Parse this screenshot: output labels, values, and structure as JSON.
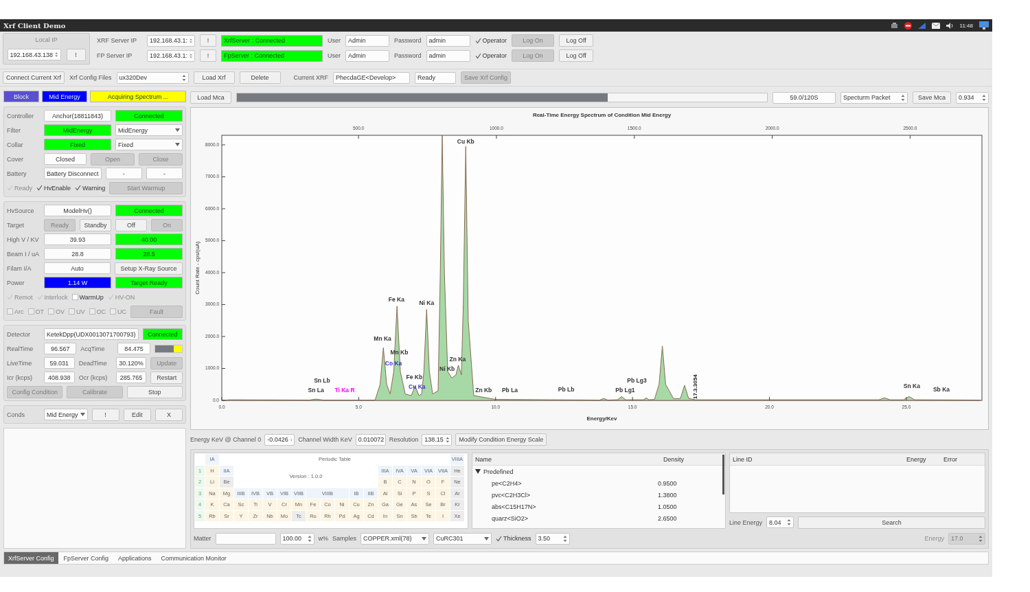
{
  "window": {
    "title": "Xrf Client Demo",
    "clock": "11:48"
  },
  "connection": {
    "local_ip": {
      "title": "Local IP",
      "ip": {
        "kind": "spin",
        "value": "192.168.43.138"
      },
      "button": {
        "kind": "button",
        "text": "!",
        "disabled": false
      }
    },
    "servers": [
      [
        {
          "kind": "label",
          "text": "XRF Server IP"
        },
        {
          "kind": "spin",
          "value": "192.168.43.1:"
        },
        {
          "kind": "button",
          "text": "!",
          "disabled": false
        },
        {
          "kind": "status",
          "text": "XrfServer : Connected",
          "color": "#00ff00"
        },
        {
          "kind": "label",
          "text": "User"
        },
        {
          "kind": "field",
          "value": "Admin"
        },
        {
          "kind": "label",
          "text": "Password"
        },
        {
          "kind": "field",
          "value": "admin"
        },
        {
          "kind": "check",
          "text": "Operator",
          "checked": true,
          "disabled": false
        },
        {
          "kind": "button",
          "text": "Log On",
          "disabled": true
        },
        {
          "kind": "button",
          "text": "Log Off",
          "disabled": false
        }
      ],
      [
        {
          "kind": "label",
          "text": "FP Server IP"
        },
        {
          "kind": "spin",
          "value": "192.168.43.1:"
        },
        {
          "kind": "button",
          "text": "!",
          "disabled": false
        },
        {
          "kind": "status",
          "text": "FpServer : Connected",
          "color": "#00ff00"
        },
        {
          "kind": "label",
          "text": "User"
        },
        {
          "kind": "field",
          "value": "Admin"
        },
        {
          "kind": "label",
          "text": "Password"
        },
        {
          "kind": "field",
          "value": "admin"
        },
        {
          "kind": "check",
          "text": "Operator",
          "checked": true,
          "disabled": false
        },
        {
          "kind": "button",
          "text": "Log On",
          "disabled": true
        },
        {
          "kind": "button",
          "text": "Log Off",
          "disabled": false
        }
      ]
    ]
  },
  "config_bar": [
    {
      "kind": "button",
      "text": "Connect Current Xrf",
      "disabled": false
    },
    {
      "kind": "label",
      "text": "Xrf Config Files"
    },
    {
      "kind": "spin",
      "value": "ux320Dev"
    },
    {
      "kind": "button",
      "text": "Load Xrf",
      "disabled": false
    },
    {
      "kind": "button",
      "text": "Delete",
      "disabled": false
    },
    {
      "kind": "label",
      "text": "Current XRF"
    },
    {
      "kind": "field",
      "value": "PhecdaGE<Develop>"
    },
    {
      "kind": "field",
      "value": "Ready"
    },
    {
      "kind": "button",
      "text": "Save Xrf Config",
      "disabled": true
    }
  ],
  "left_panel": {
    "badges": [
      {
        "kind": "status",
        "text": "Block",
        "color": "#5a4fcf"
      },
      {
        "kind": "status",
        "text": "Mid Energy",
        "color": "#0000ff"
      },
      {
        "kind": "status",
        "text": "Acquiring Spectrum ...",
        "color": "#ffff00"
      }
    ],
    "groups": [
      {
        "lines": [
          {
            "items": [
              {
                "kind": "label",
                "text": "Controller"
              },
              {
                "kind": "field",
                "value": "Anchor(18811843)"
              },
              {
                "kind": "status",
                "text": "Connected",
                "color": "#00ff00"
              }
            ]
          },
          {
            "items": [
              {
                "kind": "label",
                "text": "Filter"
              },
              {
                "kind": "status",
                "text": "MidEnergy",
                "color": "#00ff00"
              },
              {
                "kind": "combo",
                "value": "MidEnergy"
              }
            ]
          },
          {
            "items": [
              {
                "kind": "label",
                "text": "Collar"
              },
              {
                "kind": "status",
                "text": "Fixed",
                "color": "#00ff00"
              },
              {
                "kind": "combo",
                "value": "Fixed"
              }
            ]
          },
          {
            "items": [
              {
                "kind": "label",
                "text": "Cover"
              },
              {
                "kind": "field",
                "value": "Closed"
              },
              {
                "kind": "button",
                "text": "Open",
                "disabled": true
              },
              {
                "kind": "button",
                "text": "Close",
                "disabled": true
              }
            ]
          },
          {
            "items": [
              {
                "kind": "label",
                "text": "Battery"
              },
              {
                "kind": "field",
                "value": "Battery Disconnect"
              },
              {
                "kind": "field",
                "value": "-"
              },
              {
                "kind": "field",
                "value": "-"
              }
            ]
          },
          {
            "items": [
              {
                "kind": "check",
                "text": "Ready",
                "checked": true,
                "disabled": true
              },
              {
                "kind": "check",
                "text": "HvEnable",
                "checked": true,
                "disabled": false
              },
              {
                "kind": "check",
                "text": "Warning",
                "checked": true,
                "disabled": false
              },
              {
                "kind": "button",
                "text": "Start Warmup",
                "disabled": true
              }
            ]
          }
        ]
      },
      {
        "lines": [
          {
            "items": [
              {
                "kind": "label",
                "text": "HvSource"
              },
              {
                "kind": "field",
                "value": "ModelHv()"
              },
              {
                "kind": "status",
                "text": "Connected",
                "color": "#00ff00"
              }
            ]
          },
          {
            "items": [
              {
                "kind": "label",
                "text": "Target"
              },
              {
                "kind": "button",
                "text": "Ready",
                "disabled": true
              },
              {
                "kind": "button",
                "text": "Standby",
                "disabled": false
              },
              {
                "kind": "button",
                "text": "Off",
                "disabled": false
              },
              {
                "kind": "button",
                "text": "On",
                "disabled": true
              }
            ]
          },
          {
            "items": [
              {
                "kind": "label",
                "text": "High V / KV"
              },
              {
                "kind": "field",
                "value": "39.93"
              },
              {
                "kind": "status",
                "text": "40.00",
                "color": "#00ff00"
              }
            ]
          },
          {
            "items": [
              {
                "kind": "label",
                "text": "Beam I / uA"
              },
              {
                "kind": "field",
                "value": "28.8"
              },
              {
                "kind": "status",
                "text": "28.5",
                "color": "#00ff00"
              }
            ]
          },
          {
            "items": [
              {
                "kind": "label",
                "text": "Filam I/A"
              },
              {
                "kind": "field",
                "value": "Auto"
              },
              {
                "kind": "button",
                "text": "Setup X-Ray Source",
                "disabled": false
              }
            ]
          },
          {
            "items": [
              {
                "kind": "label",
                "text": "Power"
              },
              {
                "kind": "status",
                "text": "1.14 W",
                "color": "#0000ff"
              },
              {
                "kind": "status",
                "text": "Target Ready",
                "color": "#00ff00"
              }
            ]
          },
          {
            "items": [
              {
                "kind": "check",
                "text": "Remot",
                "checked": true,
                "disabled": true
              },
              {
                "kind": "check",
                "text": "Interlock",
                "checked": true,
                "disabled": true
              },
              {
                "kind": "check",
                "text": "WarmUp",
                "checked": false,
                "disabled": false
              },
              {
                "kind": "check",
                "text": "HV-ON",
                "checked": true,
                "disabled": true
              }
            ]
          },
          {
            "items": [
              {
                "kind": "check",
                "text": "Arc",
                "checked": false,
                "disabled": true
              },
              {
                "kind": "check",
                "text": "OT",
                "checked": false,
                "disabled": true
              },
              {
                "kind": "check",
                "text": "OV",
                "checked": false,
                "disabled": true
              },
              {
                "kind": "check",
                "text": "UV",
                "checked": false,
                "disabled": true
              },
              {
                "kind": "check",
                "text": "OC",
                "checked": false,
                "disabled": true
              },
              {
                "kind": "check",
                "text": "UC",
                "checked": false,
                "disabled": true
              },
              {
                "kind": "button",
                "text": "Fault",
                "disabled": true
              }
            ]
          }
        ]
      },
      {
        "lines": [
          {
            "items": [
              {
                "kind": "label",
                "text": "Detector"
              },
              {
                "kind": "field",
                "value": "KetekDpp(UDX0013071700793)"
              },
              {
                "kind": "status",
                "text": "Connected",
                "color": "#00ff00"
              }
            ]
          },
          {
            "items": [
              {
                "kind": "label",
                "text": "RealTime"
              },
              {
                "kind": "field",
                "value": "96.567"
              },
              {
                "kind": "label",
                "text": "AcqTime"
              },
              {
                "kind": "field",
                "value": "84.475"
              },
              {
                "kind": "bar",
                "level": 0.7
              }
            ]
          },
          {
            "items": [
              {
                "kind": "label",
                "text": "LiveTime"
              },
              {
                "kind": "field",
                "value": "59.031"
              },
              {
                "kind": "label",
                "text": "DeadTime"
              },
              {
                "kind": "field",
                "value": "30.120%"
              },
              {
                "kind": "button",
                "text": "Update",
                "disabled": true
              }
            ]
          },
          {
            "items": [
              {
                "kind": "label",
                "text": "Icr (kcps)"
              },
              {
                "kind": "field",
                "value": "408.938"
              },
              {
                "kind": "label",
                "text": "Ocr (kcps)"
              },
              {
                "kind": "field",
                "value": "285.765"
              },
              {
                "kind": "button",
                "text": "Restart",
                "disabled": false
              }
            ]
          },
          {
            "items": [
              {
                "kind": "button",
                "text": "Config Condition",
                "disabled": true
              },
              {
                "kind": "button",
                "text": "Calibrate",
                "disabled": true
              },
              {
                "kind": "button",
                "text": "Stop",
                "disabled": false
              }
            ]
          }
        ]
      }
    ],
    "conditions": [
      {
        "kind": "label",
        "text": "Conds"
      },
      {
        "kind": "combo",
        "value": "Mid Energy"
      },
      {
        "kind": "button",
        "text": "!",
        "disabled": false
      },
      {
        "kind": "button",
        "text": "Edit",
        "disabled": false
      },
      {
        "kind": "button",
        "text": "X",
        "disabled": false
      }
    ]
  },
  "spectrum_toolbar": [
    {
      "kind": "button",
      "text": "Load Mca",
      "disabled": false
    },
    {
      "kind": "bar",
      "level": 0.7
    },
    {
      "kind": "field",
      "value": "59.0/120S"
    },
    {
      "kind": "spin",
      "value": "Specturm Packet"
    },
    {
      "kind": "button",
      "text": "Save Mca",
      "disabled": false
    },
    {
      "kind": "spin",
      "value": "0.934"
    }
  ],
  "spectrum": {
    "top_axis_ticks": [
      "500.0",
      "1000.0",
      "1500.0",
      "2000.0",
      "2500.0"
    ],
    "peak_labels": [
      {
        "text": "Cu Kb",
        "color": "#333333"
      },
      {
        "text": "Fe Ka",
        "color": "#333333"
      },
      {
        "text": "Ni Ka",
        "color": "#333333"
      },
      {
        "text": "Mn Ka",
        "color": "#333333"
      },
      {
        "text": "Mn Kb",
        "color": "#333333"
      },
      {
        "text": "Co Ka",
        "color": "#3333cc"
      },
      {
        "text": "Zn Ka",
        "color": "#333333"
      },
      {
        "text": "Ni Kb",
        "color": "#333333"
      },
      {
        "text": "Fe Kb",
        "color": "#333333"
      },
      {
        "text": "Cu Ka",
        "color": "#3333cc"
      },
      {
        "text": "Sn Lb",
        "color": "#333333"
      },
      {
        "text": "Sn La",
        "color": "#333333"
      },
      {
        "text": "Ti Ka R",
        "color": "#ff00ff"
      },
      {
        "text": "Zn Kb",
        "color": "#333333"
      },
      {
        "text": "Pb La",
        "color": "#333333"
      },
      {
        "text": "Pb Lb",
        "color": "#333333"
      },
      {
        "text": "Pb Lg3",
        "color": "#333333"
      },
      {
        "text": "Pb Lg1",
        "color": "#333333"
      },
      {
        "text": "Sn Ka",
        "color": "#333333"
      },
      {
        "text": "Sb Ka",
        "color": "#333333"
      }
    ],
    "marker_label": "17.3.3054",
    "chart_data": {
      "type": "area",
      "title": "Real-Time Energy Spectrum of Condition Mid Energy",
      "xlabel": "Energy/Kev",
      "ylabel": "Count Rate - cps/(uA)",
      "xlim": [
        0,
        27.76
      ],
      "ylim": [
        0,
        8300
      ],
      "xticks": [
        {
          "value": 0,
          "label": "0.0"
        },
        {
          "value": 5,
          "label": "5.0"
        },
        {
          "value": 10,
          "label": "10.0"
        },
        {
          "value": 15,
          "label": "15.0"
        },
        {
          "value": 20,
          "label": "20.0"
        },
        {
          "value": 25,
          "label": "25.0"
        }
      ],
      "yticks": [
        {
          "value": 0,
          "label": "0.0"
        },
        {
          "value": 1000,
          "label": "1000.0"
        },
        {
          "value": 2000,
          "label": "2000.0"
        },
        {
          "value": 3000,
          "label": "3000.0"
        },
        {
          "value": 4000,
          "label": "4000.0"
        },
        {
          "value": 5000,
          "label": "5000.0"
        },
        {
          "value": 6000,
          "label": "6000.0"
        },
        {
          "value": 7000,
          "label": "7000.0"
        },
        {
          "value": 8000,
          "label": "8000.0"
        }
      ],
      "x": [
        0,
        0.3,
        3.2,
        3.44,
        3.7,
        5.6,
        5.78,
        5.9,
        6.02,
        6.15,
        6.28,
        6.4,
        6.52,
        6.7,
        6.92,
        7.06,
        7.2,
        7.3,
        7.38,
        7.48,
        7.58,
        7.7,
        7.9,
        7.98,
        8.05,
        8.13,
        8.25,
        8.4,
        8.55,
        8.64,
        8.75,
        8.82,
        8.91,
        9.0,
        9.2,
        10,
        13.8,
        13.95,
        14.1,
        14.45,
        14.6,
        14.75,
        15.4,
        15.5,
        15.6,
        15.8,
        15.97,
        16.09,
        16.21,
        16.5,
        16.75,
        16.9,
        17.05,
        17.3,
        24.0,
        24.2,
        24.4,
        24.9,
        25.1,
        25.3,
        27.7
      ],
      "series": [
        {
          "color": "#a6d9a6",
          "values": [
            0,
            20,
            10,
            40,
            10,
            10,
            500,
            1650,
            500,
            200,
            900,
            2950,
            900,
            200,
            150,
            450,
            150,
            200,
            900,
            2850,
            900,
            200,
            300,
            4000,
            8300,
            4000,
            900,
            700,
            800,
            1100,
            800,
            3000,
            7950,
            2500,
            150,
            30,
            10,
            60,
            10,
            20,
            120,
            20,
            20,
            80,
            20,
            30,
            500,
            1700,
            500,
            50,
            60,
            470,
            60,
            20,
            20,
            80,
            20,
            20,
            120,
            20,
            10
          ]
        }
      ]
    }
  },
  "calibration_bar": [
    {
      "kind": "label",
      "text": "Energy KeV @ Channel 0"
    },
    {
      "kind": "spin",
      "value": "-0.0426"
    },
    {
      "kind": "label",
      "text": "Channel Width KeV"
    },
    {
      "kind": "spin",
      "value": "0.010072"
    },
    {
      "kind": "label",
      "text": "Resolution"
    },
    {
      "kind": "spin",
      "value": "138.15"
    },
    {
      "kind": "button",
      "text": "Modify Condition  Energy Scale",
      "disabled": false
    }
  ],
  "periodic_table": {
    "cells": [
      {
        "kind": "blank"
      },
      {
        "kind": "group",
        "text": "IA"
      },
      {
        "kind": "title",
        "text": "Periodic Table"
      },
      {
        "kind": "group",
        "text": "VIIIA"
      },
      {
        "kind": "number",
        "text": "1"
      },
      {
        "kind": "element",
        "text": "H"
      },
      {
        "kind": "group",
        "text": "IIA"
      },
      {
        "kind": "version",
        "text": "Version : 1.0.0"
      },
      {
        "kind": "group",
        "text": "IIIA"
      },
      {
        "kind": "group",
        "text": "IVA"
      },
      {
        "kind": "group",
        "text": "VA"
      },
      {
        "kind": "group",
        "text": "VIA"
      },
      {
        "kind": "group",
        "text": "VIIA"
      },
      {
        "kind": "inactive",
        "text": "He"
      },
      {
        "kind": "number",
        "text": "2"
      },
      {
        "kind": "element",
        "text": "Li"
      },
      {
        "kind": "inactive",
        "text": "Be"
      },
      {
        "kind": "element",
        "text": "B"
      },
      {
        "kind": "element",
        "text": "C"
      },
      {
        "kind": "element",
        "text": "N"
      },
      {
        "kind": "element",
        "text": "O"
      },
      {
        "kind": "element",
        "text": "F"
      },
      {
        "kind": "inactive",
        "text": "Ne"
      },
      {
        "kind": "number",
        "text": "3"
      },
      {
        "kind": "element",
        "text": "Na"
      },
      {
        "kind": "element",
        "text": "Mg"
      },
      {
        "kind": "group",
        "text": "IIIB"
      },
      {
        "kind": "group",
        "text": "IVB"
      },
      {
        "kind": "group",
        "text": "VB"
      },
      {
        "kind": "group",
        "text": "VIB"
      },
      {
        "kind": "group",
        "text": "VIIB"
      },
      {
        "kind": "wide-group",
        "text": "VIIIB"
      },
      {
        "kind": "group",
        "text": "IB"
      },
      {
        "kind": "group",
        "text": "IIB"
      },
      {
        "kind": "element",
        "text": "Al"
      },
      {
        "kind": "element",
        "text": "Si"
      },
      {
        "kind": "element",
        "text": "P"
      },
      {
        "kind": "element",
        "text": "S"
      },
      {
        "kind": "element",
        "text": "Cl"
      },
      {
        "kind": "inactive",
        "text": "Ar"
      },
      {
        "kind": "number",
        "text": "4"
      },
      {
        "kind": "element",
        "text": "K"
      },
      {
        "kind": "element",
        "text": "Ca"
      },
      {
        "kind": "element",
        "text": "Sc"
      },
      {
        "kind": "element",
        "text": "Ti"
      },
      {
        "kind": "element",
        "text": "V"
      },
      {
        "kind": "element",
        "text": "Cr"
      },
      {
        "kind": "element",
        "text": "Mn"
      },
      {
        "kind": "element",
        "text": "Fe"
      },
      {
        "kind": "element",
        "text": "Co"
      },
      {
        "kind": "element",
        "text": "Ni"
      },
      {
        "kind": "element",
        "text": "Cu"
      },
      {
        "kind": "element",
        "text": "Zn"
      },
      {
        "kind": "element",
        "text": "Ga"
      },
      {
        "kind": "element",
        "text": "Ge"
      },
      {
        "kind": "element",
        "text": "As"
      },
      {
        "kind": "element",
        "text": "Se"
      },
      {
        "kind": "element",
        "text": "Br"
      },
      {
        "kind": "inactive",
        "text": "Kr"
      },
      {
        "kind": "number",
        "text": "5"
      },
      {
        "kind": "element",
        "text": "Rb"
      },
      {
        "kind": "element",
        "text": "Sr"
      },
      {
        "kind": "element",
        "text": "Y"
      },
      {
        "kind": "element",
        "text": "Zr"
      },
      {
        "kind": "element",
        "text": "Nb"
      },
      {
        "kind": "element",
        "text": "Mo"
      },
      {
        "kind": "inactive",
        "text": "Tc"
      },
      {
        "kind": "element",
        "text": "Ru"
      },
      {
        "kind": "element",
        "text": "Rh"
      },
      {
        "kind": "element",
        "text": "Pd"
      },
      {
        "kind": "element",
        "text": "Ag"
      },
      {
        "kind": "element",
        "text": "Cd"
      },
      {
        "kind": "element",
        "text": "In"
      },
      {
        "kind": "element",
        "text": "Sn"
      },
      {
        "kind": "element",
        "text": "Sb"
      },
      {
        "kind": "element",
        "text": "Te"
      },
      {
        "kind": "element",
        "text": "I"
      },
      {
        "kind": "inactive",
        "text": "Xe"
      }
    ]
  },
  "materials": {
    "columns": [
      "Name",
      "Density"
    ],
    "groups": [
      {
        "name": "Predefined",
        "expanded": true,
        "children": [
          {
            "name": "pe<C2H4>",
            "density": "0.9500"
          },
          {
            "name": "pvc<C2H3Cl>",
            "density": "1.3800"
          },
          {
            "name": "abs<C15H17N>",
            "density": "1.0500"
          },
          {
            "name": "quarz<SiO2>",
            "density": "2.6500"
          }
        ]
      }
    ]
  },
  "line_id": {
    "columns": [
      "Line ID",
      "Energy",
      "Error"
    ],
    "controls": [
      {
        "kind": "label",
        "text": "Line Energy"
      },
      {
        "kind": "spin",
        "value": "8.04"
      },
      {
        "kind": "button",
        "text": "Search",
        "disabled": false
      }
    ]
  },
  "sample_bar": [
    {
      "kind": "label",
      "text": "Matter"
    },
    {
      "kind": "field"
    },
    {
      "kind": "spin",
      "value": "100.00"
    },
    {
      "kind": "label",
      "text": "w%"
    },
    {
      "kind": "label",
      "text": "Samples"
    },
    {
      "kind": "combo",
      "value": "COPPER.xml(78)"
    },
    {
      "kind": "combo",
      "value": "CuRC301"
    },
    {
      "kind": "check",
      "text": "Thickness",
      "checked": true,
      "disabled": false
    },
    {
      "kind": "spin",
      "value": "3.50"
    }
  ],
  "energy_setting": [
    {
      "kind": "label",
      "text": "Energy",
      "disabled": true
    },
    {
      "kind": "spin",
      "value": "17.0",
      "disabled": true
    }
  ],
  "bottom_tabs": [
    {
      "label": "XrfServer Config",
      "selected": true
    },
    {
      "label": "FpServer Config",
      "selected": false
    },
    {
      "label": "Applications",
      "selected": false
    },
    {
      "label": "Communication Monitor",
      "selected": false
    }
  ]
}
